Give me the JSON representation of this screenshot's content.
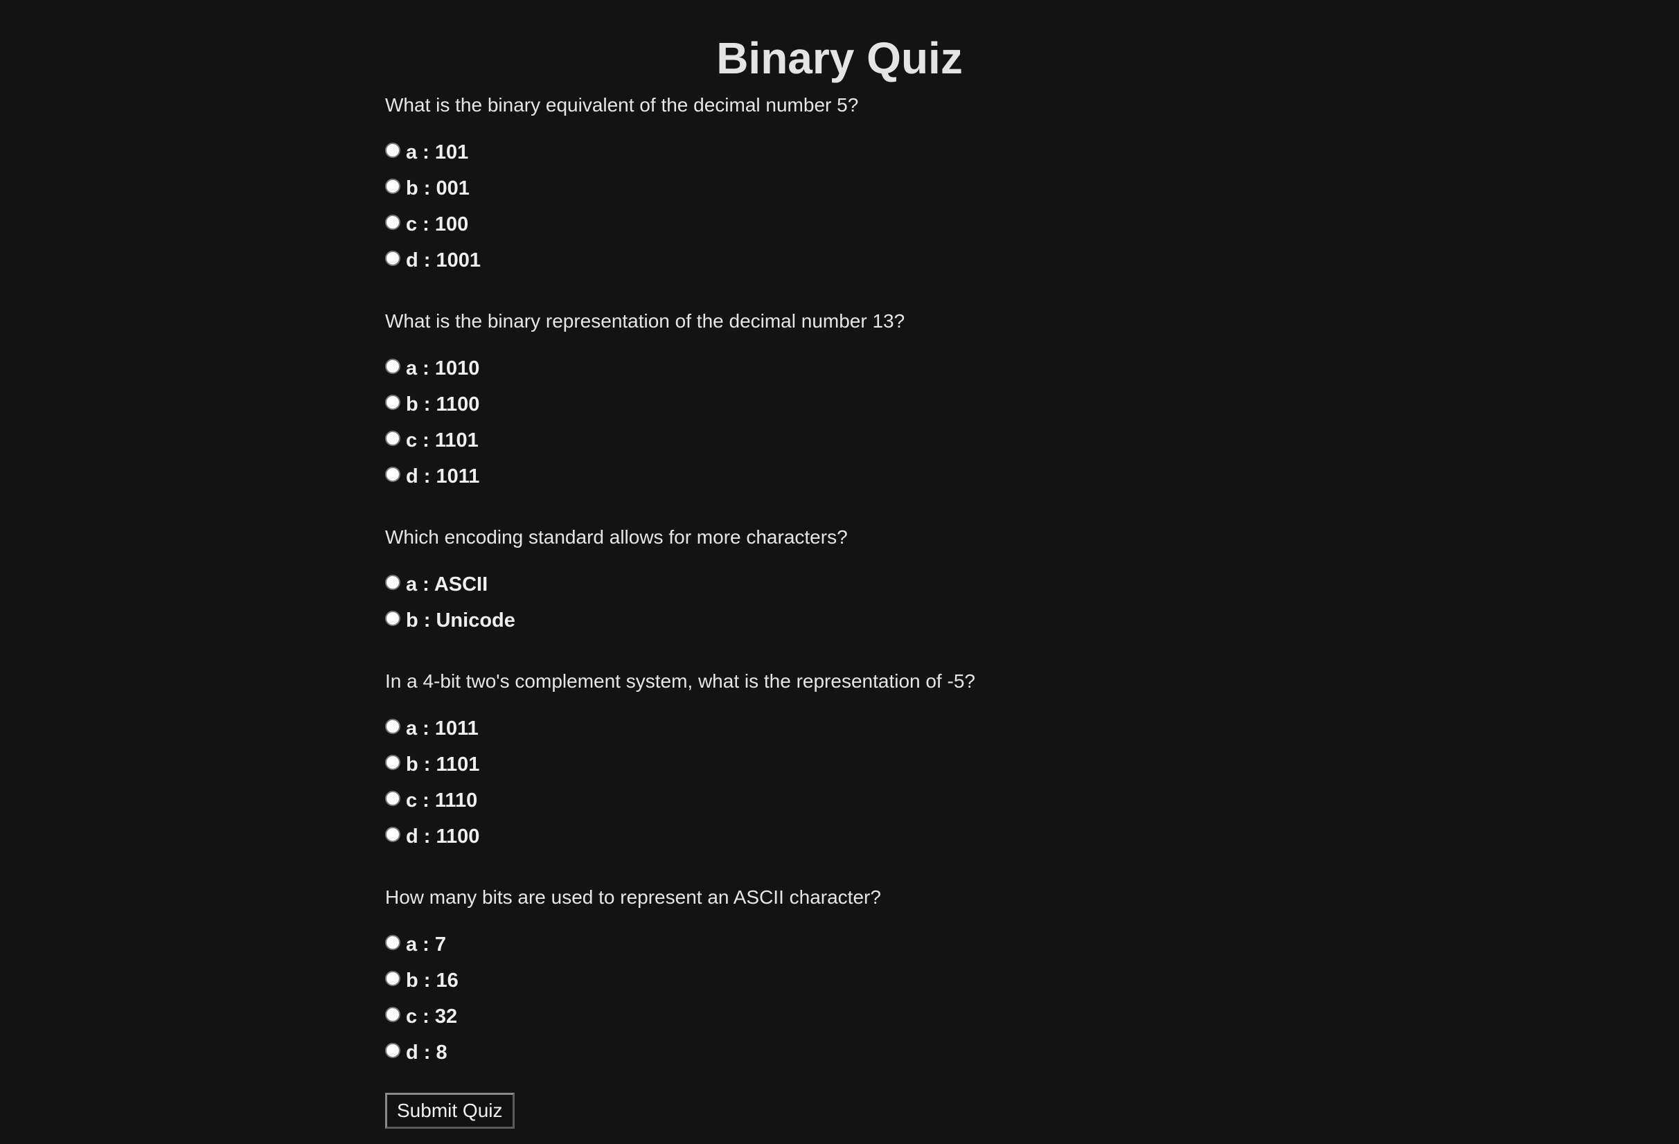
{
  "page": {
    "title": "Binary Quiz"
  },
  "questions": [
    {
      "text": "What is the binary equivalent of the decimal number 5?",
      "options": [
        {
          "label": "a : 101"
        },
        {
          "label": "b : 001"
        },
        {
          "label": "c : 100"
        },
        {
          "label": "d : 1001"
        }
      ]
    },
    {
      "text": "What is the binary representation of the decimal number 13?",
      "options": [
        {
          "label": "a : 1010"
        },
        {
          "label": "b : 1100"
        },
        {
          "label": "c : 1101"
        },
        {
          "label": "d : 1011"
        }
      ]
    },
    {
      "text": "Which encoding standard allows for more characters?",
      "options": [
        {
          "label": "a : ASCII"
        },
        {
          "label": "b : Unicode"
        }
      ]
    },
    {
      "text": "In a 4-bit two's complement system, what is the representation of -5?",
      "options": [
        {
          "label": "a : 1011"
        },
        {
          "label": "b : 1101"
        },
        {
          "label": "c : 1110"
        },
        {
          "label": "d : 1100"
        }
      ]
    },
    {
      "text": "How many bits are used to represent an ASCII character?",
      "options": [
        {
          "label": "a : 7"
        },
        {
          "label": "b : 16"
        },
        {
          "label": "c : 32"
        },
        {
          "label": "d : 8"
        }
      ]
    }
  ],
  "submit": {
    "label": "Submit Quiz"
  },
  "colors": {
    "background": "#131313",
    "text": "#e8e8e8",
    "radio_fill": "#ffffff"
  }
}
